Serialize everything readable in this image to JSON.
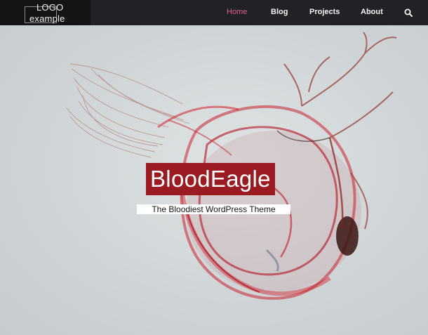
{
  "logo": {
    "line1": "LOGO",
    "line2": "example"
  },
  "nav": {
    "items": [
      {
        "label": "Home",
        "active": true
      },
      {
        "label": "Blog",
        "active": false
      },
      {
        "label": "Projects",
        "active": false
      },
      {
        "label": "About",
        "active": false
      }
    ],
    "search_icon": "search-icon"
  },
  "hero": {
    "title": "BloodEagle",
    "subtitle": "The Bloodiest WordPress Theme"
  },
  "colors": {
    "nav_bg": "#212226",
    "active_link": "#e0608a",
    "title_bg": "#9b1b22",
    "hero_bg": "#d3d8da"
  }
}
